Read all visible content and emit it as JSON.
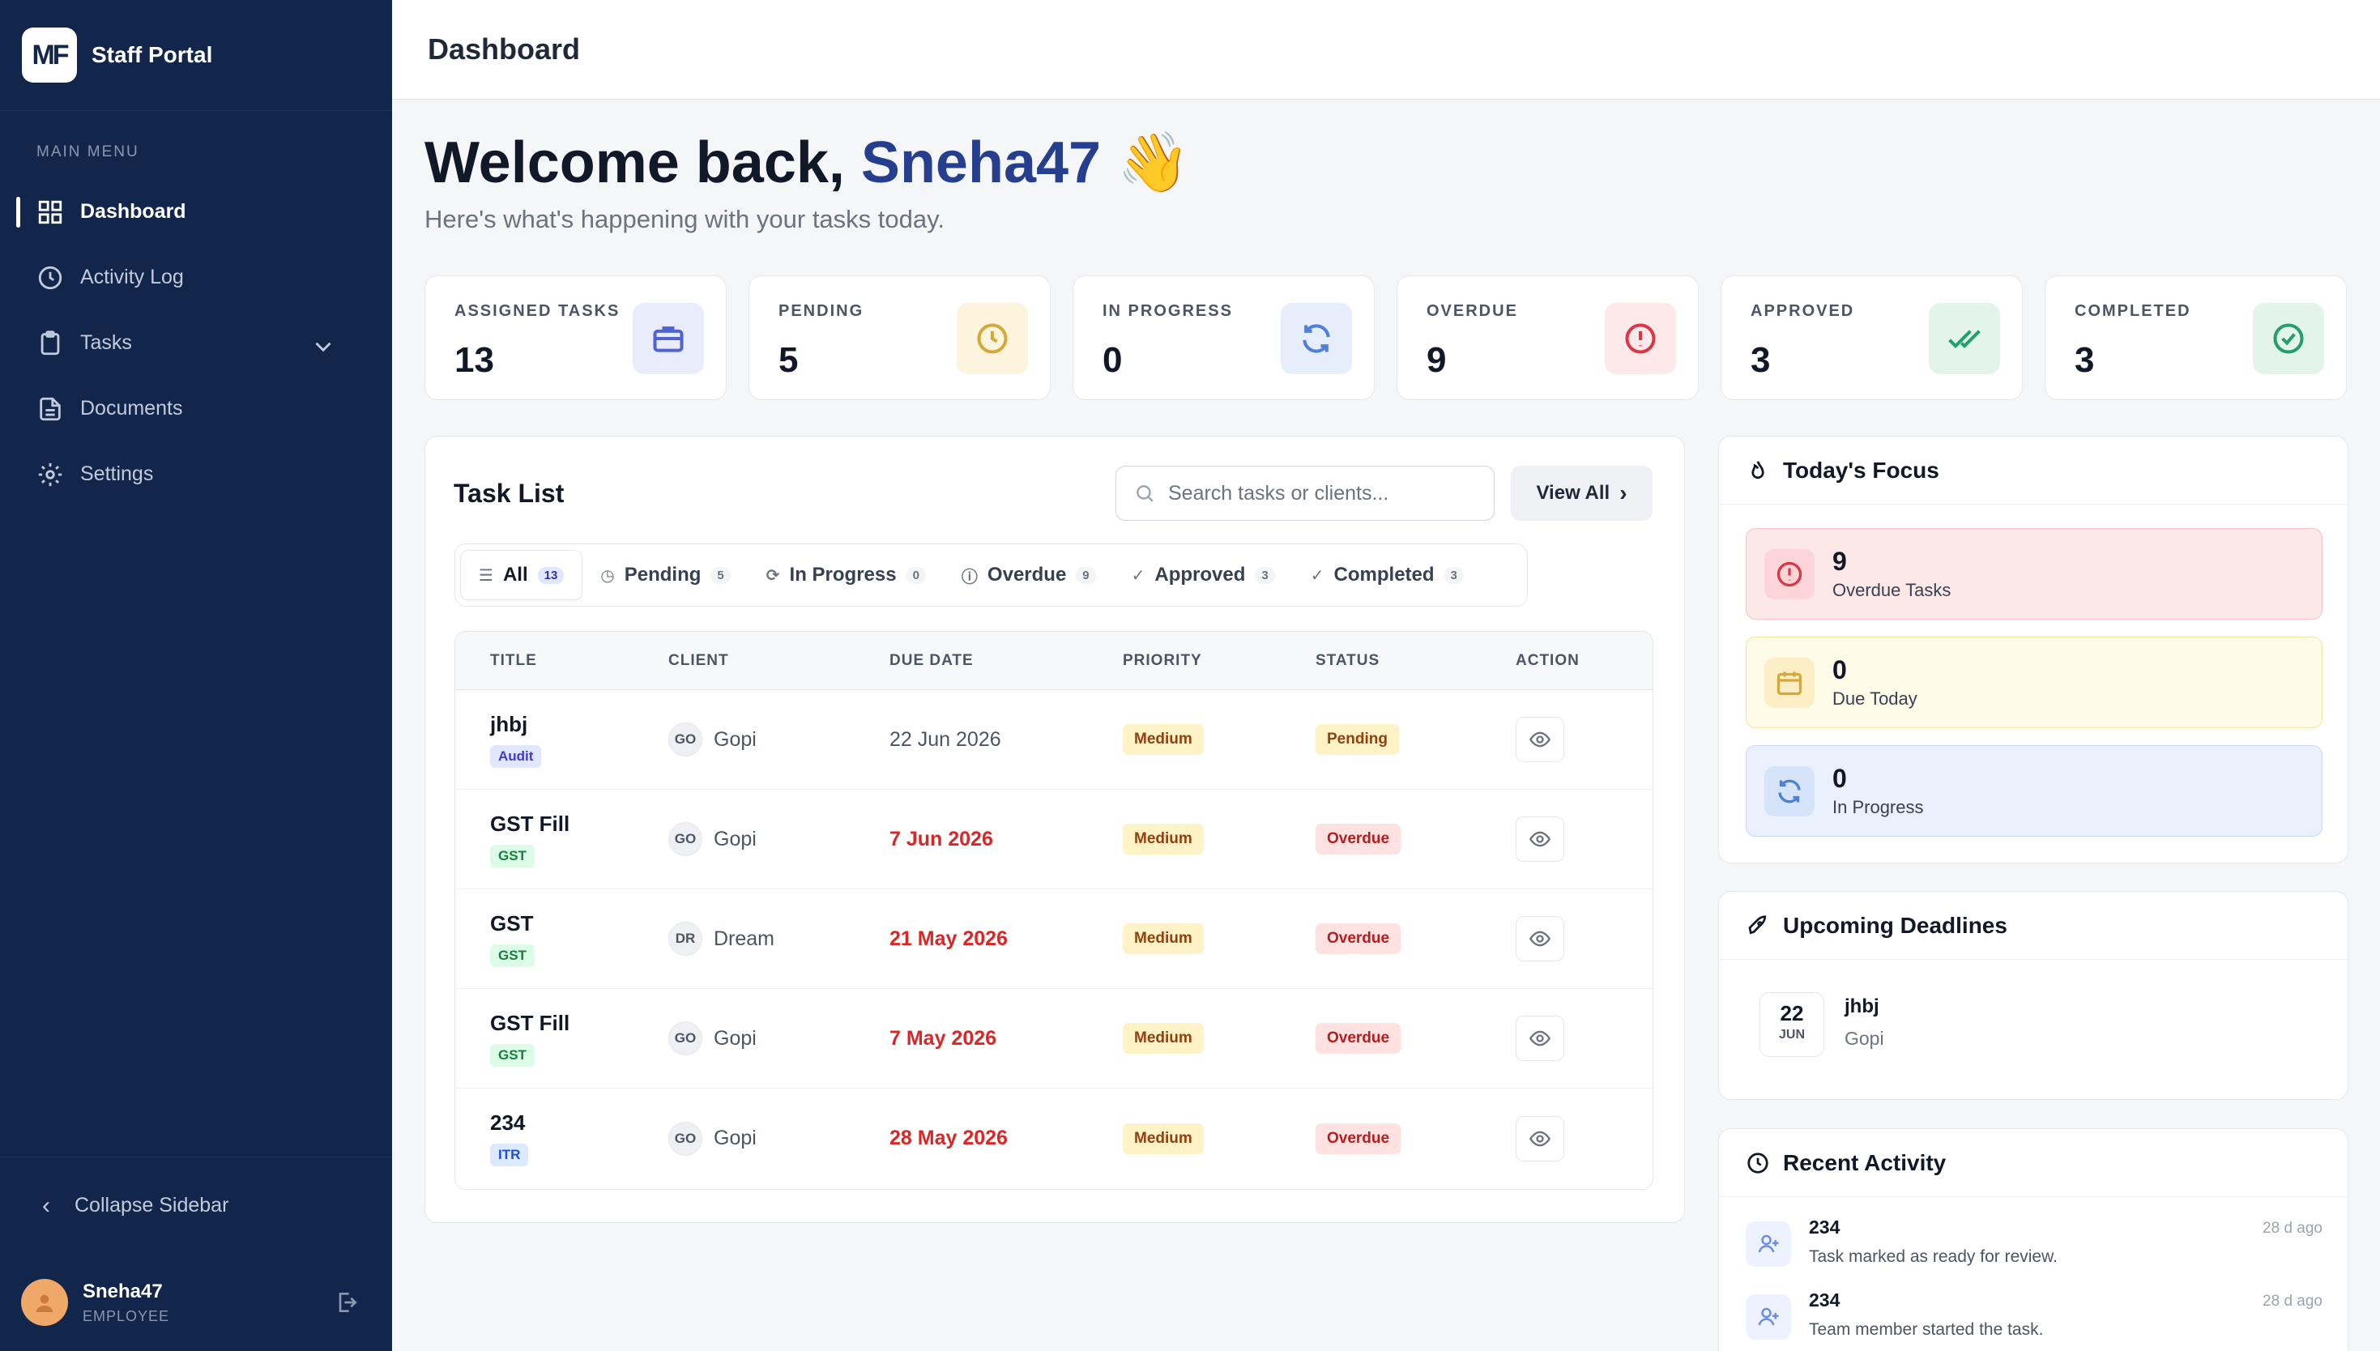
{
  "sidebar": {
    "brand_logo": "MF",
    "brand_name": "Staff Portal",
    "menu_label": "MAIN MENU",
    "items": [
      {
        "label": "Dashboard",
        "icon": "grid-icon",
        "active": true
      },
      {
        "label": "Activity Log",
        "icon": "clock-icon"
      },
      {
        "label": "Tasks",
        "icon": "clipboard-icon",
        "has_submenu": true
      },
      {
        "label": "Documents",
        "icon": "file-icon"
      },
      {
        "label": "Settings",
        "icon": "gear-icon"
      }
    ],
    "collapse_label": "Collapse Sidebar",
    "user": {
      "name": "Sneha47",
      "role": "EMPLOYEE"
    }
  },
  "topbar": {
    "title": "Dashboard"
  },
  "welcome": {
    "prefix": "Welcome back,",
    "username": "Sneha47",
    "emoji": "👋",
    "subtitle": "Here's what's happening with your tasks today."
  },
  "stats": [
    {
      "label": "ASSIGNED TASKS",
      "value": "13",
      "icon": "briefcase-icon",
      "color": "#4f63d2",
      "bg": "#e8ecfb"
    },
    {
      "label": "PENDING",
      "value": "5",
      "icon": "clock-icon",
      "color": "#d4a93a",
      "bg": "#fdf4dd"
    },
    {
      "label": "IN PROGRESS",
      "value": "0",
      "icon": "refresh-icon",
      "color": "#4f7fd6",
      "bg": "#e6eefb"
    },
    {
      "label": "OVERDUE",
      "value": "9",
      "icon": "alert-icon",
      "color": "#dc3545",
      "bg": "#fde8ea"
    },
    {
      "label": "APPROVED",
      "value": "3",
      "icon": "double-check-icon",
      "color": "#22a06b",
      "bg": "#e3f4ea"
    },
    {
      "label": "COMPLETED",
      "value": "3",
      "icon": "check-circle-icon",
      "color": "#22a06b",
      "bg": "#e3f4ea"
    }
  ],
  "task_list": {
    "title": "Task List",
    "search_placeholder": "Search tasks or clients...",
    "view_all": "View All",
    "tabs": [
      {
        "label": "All",
        "count": "13",
        "icon": "list-icon",
        "active": true
      },
      {
        "label": "Pending",
        "count": "5",
        "icon": "clock-icon"
      },
      {
        "label": "In Progress",
        "count": "0",
        "icon": "refresh-icon"
      },
      {
        "label": "Overdue",
        "count": "9",
        "icon": "alert-icon"
      },
      {
        "label": "Approved",
        "count": "3",
        "icon": "double-check-icon"
      },
      {
        "label": "Completed",
        "count": "3",
        "icon": "check-circle-icon"
      }
    ],
    "columns": [
      "TITLE",
      "CLIENT",
      "DUE DATE",
      "PRIORITY",
      "STATUS",
      "ACTION"
    ],
    "rows": [
      {
        "title": "jhbj",
        "tag": "Audit",
        "tag_color": "#4338ca",
        "tag_bg": "#e0e7ff",
        "client_initials": "GO",
        "client": "Gopi",
        "due": "22 Jun 2026",
        "due_overdue": false,
        "priority": "Medium",
        "status": "Pending"
      },
      {
        "title": "GST Fill",
        "tag": "GST",
        "tag_color": "#15803d",
        "tag_bg": "#dcfce7",
        "client_initials": "GO",
        "client": "Gopi",
        "due": "7 Jun 2026",
        "due_overdue": true,
        "priority": "Medium",
        "status": "Overdue"
      },
      {
        "title": "GST",
        "tag": "GST",
        "tag_color": "#15803d",
        "tag_bg": "#dcfce7",
        "client_initials": "DR",
        "client": "Dream",
        "due": "21 May 2026",
        "due_overdue": true,
        "priority": "Medium",
        "status": "Overdue"
      },
      {
        "title": "GST Fill",
        "tag": "GST",
        "tag_color": "#15803d",
        "tag_bg": "#dcfce7",
        "client_initials": "GO",
        "client": "Gopi",
        "due": "7 May 2026",
        "due_overdue": true,
        "priority": "Medium",
        "status": "Overdue"
      },
      {
        "title": "234",
        "tag": "ITR",
        "tag_color": "#1d4ed8",
        "tag_bg": "#dbeafe",
        "client_initials": "GO",
        "client": "Gopi",
        "due": "28 May 2026",
        "due_overdue": true,
        "priority": "Medium",
        "status": "Overdue"
      }
    ]
  },
  "focus": {
    "title": "Today's Focus",
    "items": [
      {
        "value": "9",
        "label": "Overdue Tasks",
        "icon": "alert-icon",
        "color": "#dc3545",
        "bg": "#fde8e8",
        "border": "#f5c2c7",
        "icon_bg": "#fbd5d8"
      },
      {
        "value": "0",
        "label": "Due Today",
        "icon": "calendar-icon",
        "color": "#d4a93a",
        "bg": "#fefbe8",
        "border": "#f5e3a6",
        "icon_bg": "#fcefc5"
      },
      {
        "value": "0",
        "label": "In Progress",
        "icon": "refresh-icon",
        "color": "#4f7fd6",
        "bg": "#eaf1fd",
        "border": "#c7d8f6",
        "icon_bg": "#d6e4fa"
      }
    ]
  },
  "deadlines": {
    "title": "Upcoming Deadlines",
    "items": [
      {
        "day": "22",
        "month": "JUN",
        "title": "jhbj",
        "client": "Gopi"
      }
    ]
  },
  "recent": {
    "title": "Recent Activity",
    "items": [
      {
        "title": "234",
        "desc": "Task marked as ready for review.",
        "time": "28 d ago"
      },
      {
        "title": "234",
        "desc": "Team member started the task.",
        "time": "28 d ago"
      }
    ]
  },
  "colors": {
    "sidebar_bg": "#12264b",
    "accent": "#263e8e",
    "overdue_text": "#dc2626",
    "priority_bg": "#fef3c7",
    "priority_text": "#92400e",
    "pending_bg": "#fef3c7",
    "pending_text": "#92400e",
    "overdue_badge_bg": "#fee2e2",
    "overdue_badge_text": "#b91c1c"
  }
}
